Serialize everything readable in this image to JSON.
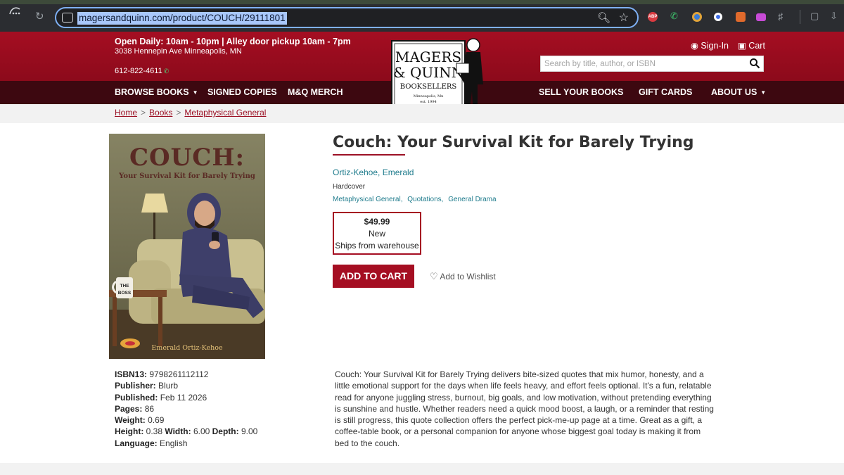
{
  "browser": {
    "url": "magersandquinn.com/product/COUCH/29111801",
    "extensions": [
      "abp-icon",
      "phone-icon",
      "chrome-circle-icon",
      "circle-icon",
      "fox-icon",
      "video-icon",
      "puzzle-icon"
    ],
    "abp_label": "ABP"
  },
  "header": {
    "hours": "Open Daily: 10am - 10pm | Alley door pickup 10am - 7pm",
    "address": "3038 Hennepin Ave Minneapolis, MN",
    "phone": "612-822-4611",
    "signin_label": "Sign-In",
    "cart_label": "Cart",
    "search_placeholder": "Search by title, author, or ISBN"
  },
  "logo": {
    "line1": "MAGERS",
    "line2": "& QUINN",
    "line3": "BOOKSELLERS",
    "line4": "Minneapolis, Mn",
    "line5": "est. 1994"
  },
  "nav": {
    "left": [
      "BROWSE BOOKS",
      "SIGNED COPIES",
      "M&Q MERCH"
    ],
    "right": [
      "SELL YOUR BOOKS",
      "GIFT CARDS",
      "ABOUT US"
    ]
  },
  "breadcrumb": [
    "Home",
    "Books",
    "Metaphysical General"
  ],
  "breadcrumb_sep": ">",
  "product": {
    "title": "Couch: Your Survival Kit for Barely Trying",
    "author": "Ortiz-Kehoe, Emerald",
    "format": "Hardcover",
    "categories": [
      "Metaphysical General,",
      "Quotations,",
      "General Drama"
    ],
    "price": "$49.99",
    "condition": "New",
    "shipping": "Ships from warehouse",
    "add_to_cart": "ADD TO CART",
    "wishlist": "Add to Wishlist"
  },
  "cover": {
    "title": "COUCH:",
    "subtitle": "Your Survival Kit for Barely Trying",
    "author": "Emerald Ortiz-Kehoe",
    "mug_text_1": "THE",
    "mug_text_2": "BOSS"
  },
  "specs": [
    {
      "label": "ISBN13:",
      "value": "9798261112112"
    },
    {
      "label": "Publisher:",
      "value": "Blurb"
    },
    {
      "label": "Published:",
      "value": "Feb 11 2026"
    },
    {
      "label": "Pages:",
      "value": "86"
    },
    {
      "label": "Weight:",
      "value": "0.69"
    }
  ],
  "dims": {
    "height_label": "Height:",
    "height": "0.38",
    "width_label": "Width:",
    "width": "6.00",
    "depth_label": "Depth:",
    "depth": "9.00"
  },
  "language": {
    "label": "Language:",
    "value": "English"
  },
  "description": "Couch: Your Survival Kit for Barely Trying delivers bite-sized quotes that mix humor, honesty, and a little emotional support for the days when life feels heavy, and effort feels optional. It's a fun, relatable read for anyone juggling stress, burnout, big goals, and low motivation, without pretending everything is sunshine and hustle. Whether readers need a quick mood boost, a laugh, or a reminder that resting is still progress, this quote collection offers the perfect pick-me-up page at a time. Great as a gift, a coffee-table book, or a personal companion for anyone whose biggest goal today is making it from bed to the couch.",
  "colors": {
    "brand_red": "#a50e22",
    "nav_dark": "#3d0810",
    "link_teal": "#1e7b8c"
  }
}
